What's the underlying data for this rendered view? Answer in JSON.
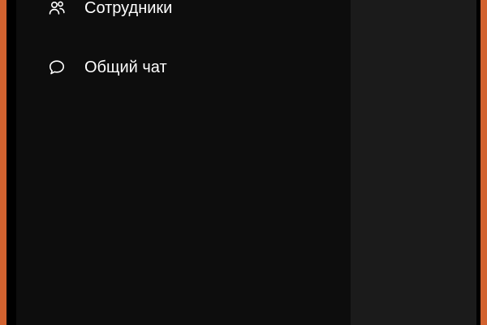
{
  "colors": {
    "frame_accent": "#d2622f",
    "sidebar_bg": "#0d0d0d",
    "right_pane_bg": "#1b1b1b",
    "text": "#ffffff"
  },
  "sidebar": {
    "items": [
      {
        "label": "Сотрудники",
        "icon": "users-icon"
      },
      {
        "label": "Общий чат",
        "icon": "chat-bubble-icon"
      }
    ]
  }
}
